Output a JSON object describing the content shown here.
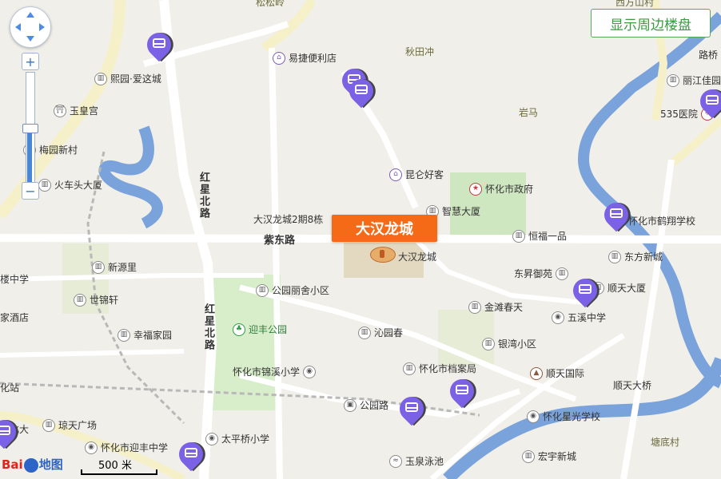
{
  "show_button": {
    "label": "显示周边楼盘"
  },
  "main_marker": {
    "label": "大汉龙城"
  },
  "roads": {
    "hongxing_north_a": "红星北路",
    "hongxing_north_b": "红星北路",
    "zidong": "紫东路"
  },
  "places": {
    "qiutianchong": "秋田冲",
    "yanma": "岩马",
    "tangdicun": "塘底村",
    "top_cut": "松松岭",
    "top_right_cut": "西方山村"
  },
  "pois": [
    {
      "label": "易捷便利店",
      "icon": "shop-icon",
      "tone": "purple"
    },
    {
      "label": "熙园·爱这城",
      "icon": "building-icon",
      "tone": "gray"
    },
    {
      "label": "玉皇宫",
      "icon": "temple-icon",
      "tone": "gray"
    },
    {
      "label": "梅园新村",
      "icon": "building-icon",
      "tone": "gray"
    },
    {
      "label": "火车头大厦",
      "icon": "building-icon",
      "tone": "gray"
    },
    {
      "label": "昆仑好客",
      "icon": "shop-icon",
      "tone": "purple"
    },
    {
      "label": "怀化市政府",
      "icon": "government-icon",
      "tone": "red"
    },
    {
      "label": "智慧大厦",
      "icon": "building-icon",
      "tone": "gray"
    },
    {
      "label": "大汉龙城2期8栋",
      "icon": "",
      "tone": "gray"
    },
    {
      "label": "恒福一品",
      "icon": "building-icon",
      "tone": "gray"
    },
    {
      "label": "大汉龙城",
      "icon": "",
      "tone": "gray"
    },
    {
      "label": "新源里",
      "icon": "building-icon",
      "tone": "gray"
    },
    {
      "label": "东方新城",
      "icon": "building-icon",
      "tone": "gray"
    },
    {
      "label": "东昇御苑",
      "icon": "building-icon",
      "tone": "gray"
    },
    {
      "label": "顺天大厦",
      "icon": "building-icon",
      "tone": "gray"
    },
    {
      "label": "公园丽舍小区",
      "icon": "building-icon",
      "tone": "gray"
    },
    {
      "label": "世锦轩",
      "icon": "building-icon",
      "tone": "gray"
    },
    {
      "label": "金滩春天",
      "icon": "building-icon",
      "tone": "gray"
    },
    {
      "label": "五溪中学",
      "icon": "school-icon",
      "tone": "gray"
    },
    {
      "label": "幸福家园",
      "icon": "building-icon",
      "tone": "gray"
    },
    {
      "label": "迎丰公园",
      "icon": "park-icon",
      "tone": "green"
    },
    {
      "label": "沁园春",
      "icon": "building-icon",
      "tone": "gray"
    },
    {
      "label": "银湾小区",
      "icon": "building-icon",
      "tone": "gray"
    },
    {
      "label": "怀化市档案局",
      "icon": "building-icon",
      "tone": "gray"
    },
    {
      "label": "怀化市锦溪小学",
      "icon": "school-icon",
      "tone": "gray"
    },
    {
      "label": "顺天国际",
      "icon": "tower-icon",
      "tone": "brown"
    },
    {
      "label": "顺天大桥",
      "icon": "",
      "tone": "gray"
    },
    {
      "label": "公园路",
      "icon": "bus-stop-icon",
      "tone": "gray"
    },
    {
      "label": "琼天广场",
      "icon": "building-icon",
      "tone": "gray"
    },
    {
      "label": "怀化星光学校",
      "icon": "school-icon",
      "tone": "gray"
    },
    {
      "label": "太平桥小学",
      "icon": "school-icon",
      "tone": "gray"
    },
    {
      "label": "怀化市迎丰中学",
      "icon": "school-icon",
      "tone": "gray"
    },
    {
      "label": "玉泉泳池",
      "icon": "pool-icon",
      "tone": "gray"
    },
    {
      "label": "宏宇新城",
      "icon": "building-icon",
      "tone": "gray"
    },
    {
      "label": "怀化市鹤翔学校",
      "icon": "school-icon",
      "tone": "gray"
    },
    {
      "label": "丽江佳园",
      "icon": "building-icon",
      "tone": "gray"
    },
    {
      "label": "535医院",
      "icon": "hospital-icon",
      "tone": "red"
    },
    {
      "label": "路桥",
      "icon": "",
      "tone": "gray"
    },
    {
      "label": "楼中学",
      "icon": "",
      "tone": "gray"
    },
    {
      "label": "家酒店",
      "icon": "",
      "tone": "gray"
    },
    {
      "label": "化站",
      "icon": "",
      "tone": "gray"
    },
    {
      "label": "怀化大",
      "icon": "",
      "tone": "gray"
    }
  ],
  "bus_markers": 10,
  "map_controls": {
    "zoom_in": "+",
    "zoom_out": "−",
    "zoom_level": 0.5
  },
  "scale": {
    "label": "500 米"
  },
  "brand": {
    "left": "Bai",
    "right": "地图"
  },
  "colors": {
    "primary_road": "#f5f0c8",
    "road": "#ffffff",
    "river": "#7aa3dc",
    "park": "#cfe7c0",
    "accent": "#f46a17",
    "bus_pin": "#7b61e6"
  }
}
